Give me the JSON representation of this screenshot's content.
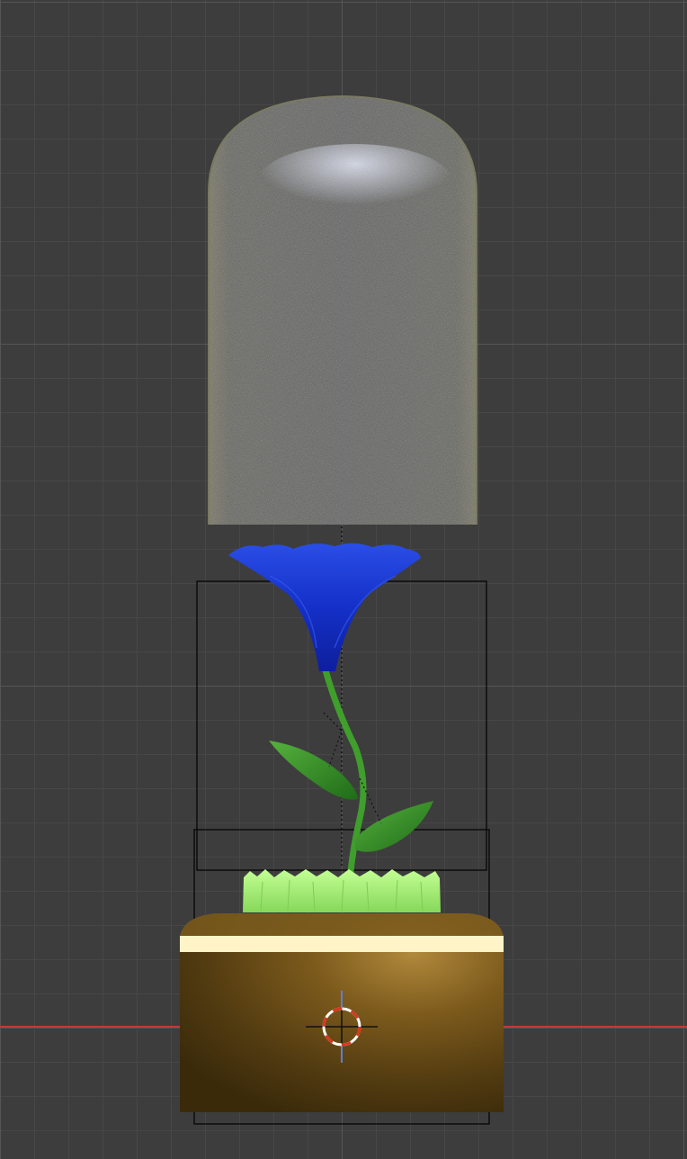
{
  "viewport": {
    "background": "#3d3d3d",
    "grid_minor": "#474747",
    "grid_major": "#565656",
    "x_axis_color": "#c5383a"
  },
  "objects": {
    "glass_dome": {
      "icon": "glass-dome-icon",
      "color": "#8c8c84"
    },
    "flower_head": {
      "icon": "flower-icon",
      "color": "#1430c8"
    },
    "stem": {
      "icon": "stem-icon",
      "color": "#3f9e2c"
    },
    "leaves": {
      "icon": "leaf-icon",
      "color": "#2f8a23"
    },
    "grass": {
      "icon": "grass-icon",
      "color": "#a6f07a"
    },
    "pot": {
      "icon": "pot-icon",
      "color": "#6e4f16",
      "rim_color": "#fff4c8"
    }
  },
  "cursor_3d": {
    "icon": "3d-cursor-icon",
    "colors": [
      "#d8361e",
      "#ffffff"
    ]
  },
  "selection": {
    "outline_color": "#000000"
  }
}
